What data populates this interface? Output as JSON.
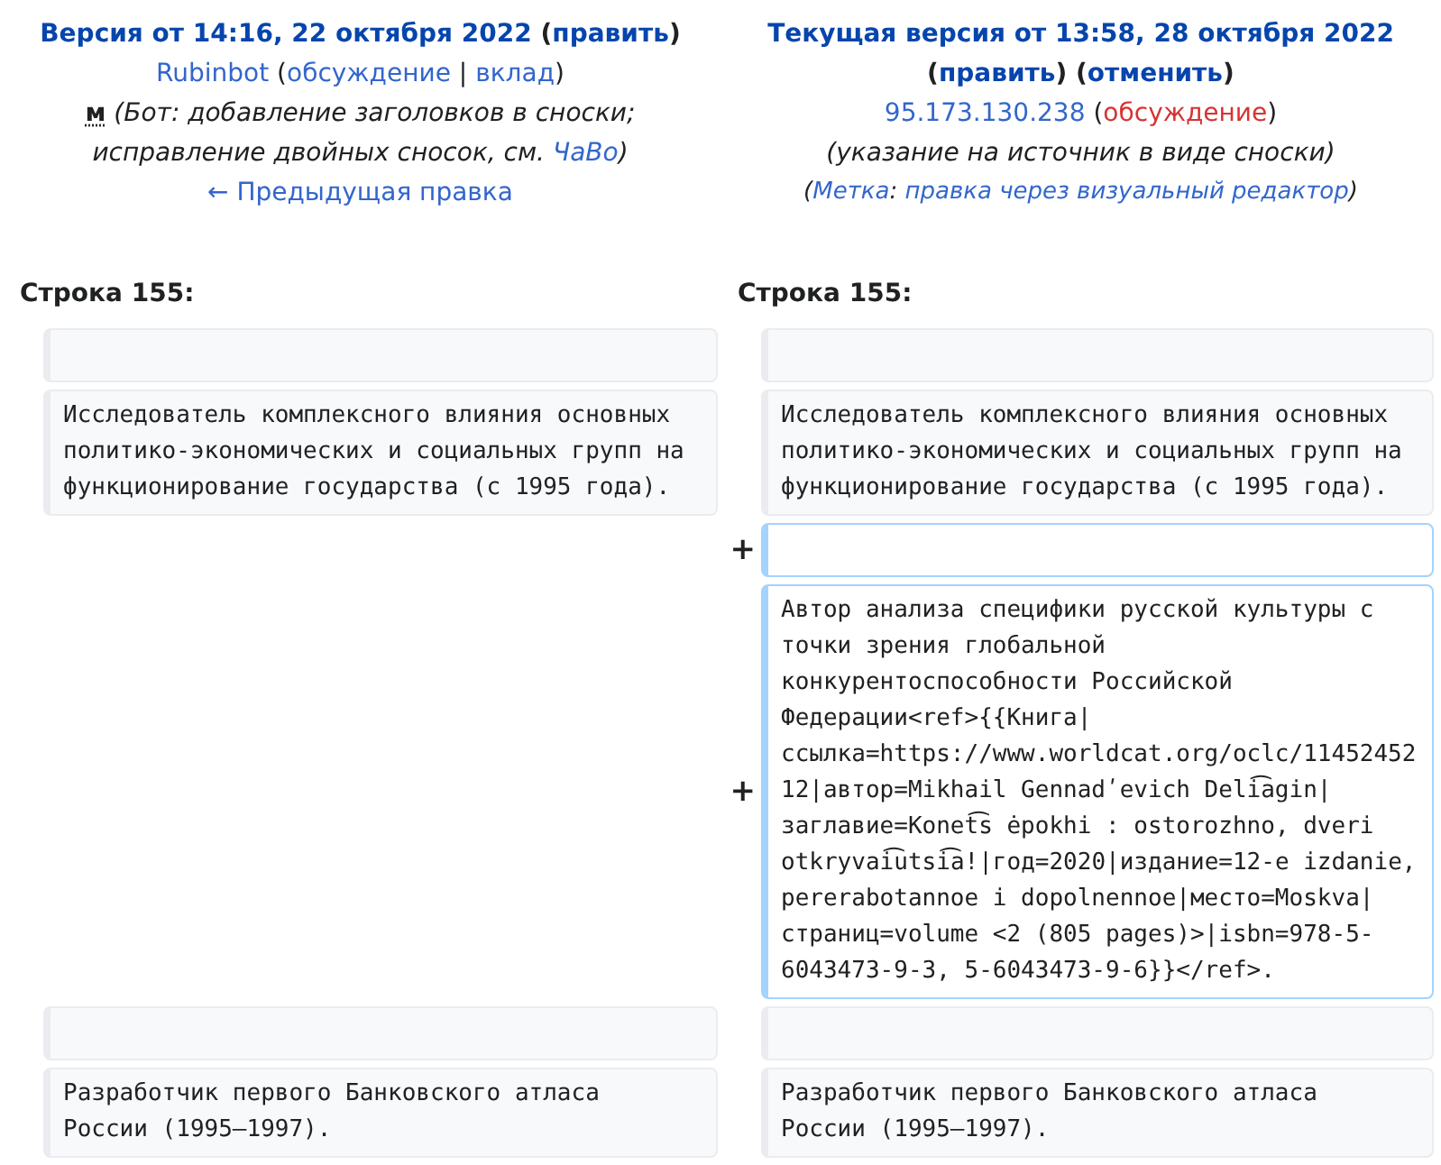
{
  "revisions": [
    {
      "lines": [
        {
          "kind": "heading",
          "segments": [
            {
              "kind": "link",
              "text": "Версия от 14:16, 22 октября 2022"
            },
            {
              "kind": "plain",
              "text": " ("
            },
            {
              "kind": "link",
              "text": "править"
            },
            {
              "kind": "plain",
              "text": ")"
            }
          ]
        },
        {
          "kind": "author",
          "segments": [
            {
              "kind": "link",
              "text": "Rubinbot"
            },
            {
              "kind": "plain",
              "text": " ("
            },
            {
              "kind": "link",
              "text": "обсуждение"
            },
            {
              "kind": "plain",
              "text": " | "
            },
            {
              "kind": "link",
              "text": "вклад"
            },
            {
              "kind": "plain",
              "text": ")"
            }
          ]
        },
        {
          "kind": "comment",
          "segments": [
            {
              "kind": "minor",
              "text": "м"
            },
            {
              "kind": "plain",
              "text": " (Бот: добавление заголовков в сноски; исправление двойных сносок, см. "
            },
            {
              "kind": "link",
              "text": "ЧаВо"
            },
            {
              "kind": "plain",
              "text": ")"
            }
          ]
        },
        {
          "kind": "nav",
          "segments": [
            {
              "kind": "link",
              "text": "← Предыдущая правка"
            }
          ]
        }
      ]
    },
    {
      "lines": [
        {
          "kind": "heading",
          "segments": [
            {
              "kind": "link",
              "text": "Текущая версия от 13:58, 28 октября 2022"
            },
            {
              "kind": "plain",
              "text": " ("
            },
            {
              "kind": "link",
              "text": "править"
            },
            {
              "kind": "plain",
              "text": ") ("
            },
            {
              "kind": "link",
              "text": "отменить"
            },
            {
              "kind": "plain",
              "text": ")"
            }
          ]
        },
        {
          "kind": "author",
          "segments": [
            {
              "kind": "link",
              "text": "95.173.130.238"
            },
            {
              "kind": "plain",
              "text": " ("
            },
            {
              "kind": "redlink",
              "text": "обсуждение"
            },
            {
              "kind": "plain",
              "text": ")"
            }
          ]
        },
        {
          "kind": "comment",
          "segments": [
            {
              "kind": "plain",
              "text": "(указание на источник в виде сноски)"
            }
          ]
        },
        {
          "kind": "tag",
          "segments": [
            {
              "kind": "plain",
              "text": "("
            },
            {
              "kind": "link",
              "text": "Метка"
            },
            {
              "kind": "plain",
              "text": ": "
            },
            {
              "kind": "link",
              "text": "правка через визуальный редактор"
            },
            {
              "kind": "plain",
              "text": ")"
            }
          ]
        }
      ]
    }
  ],
  "diff": {
    "line_headers": [
      "Строка 155:",
      "Строка 155:"
    ],
    "rows": [
      {
        "cells": [
          {
            "kind": "context"
          },
          {
            "kind": "context"
          }
        ]
      },
      {
        "cells": [
          {
            "kind": "context",
            "text": "Исследователь комплексного влияния основных политико-экономических и социальных групп на функционирование государства (с 1995 года)."
          },
          {
            "kind": "context",
            "text": "Исследователь комплексного влияния основных политико-экономических и социальных групп на функционирование государства (с 1995 года)."
          }
        ]
      },
      {
        "cells": [
          {
            "kind": "empty"
          },
          {
            "kind": "added",
            "marker": "+"
          }
        ]
      },
      {
        "cells": [
          {
            "kind": "empty"
          },
          {
            "kind": "added",
            "marker": "+",
            "text": "Автор анализа специфики русской культуры с точки зрения глобальной конкурентоспособности Российской Федерации<ref>{{Книга|ссылка=https://www.worldcat.org/oclc/1145245212|автор=Mikhail Gennadʹevich Deli͡agin|заглавие=Konet͡s ėpokhi : ostorozhno, dveri otkryvai͡utsi͡a!|год=2020|издание=12-e izdanie, pererabotannoe i dopolnennoe|место=Moskva|страниц=volume <2 (805 pages)>|isbn=978-5-6043473-9-3, 5-6043473-9-6}}</ref>."
          }
        ]
      },
      {
        "cells": [
          {
            "kind": "context"
          },
          {
            "kind": "context"
          }
        ]
      },
      {
        "cells": [
          {
            "kind": "context",
            "text": "Разработчик первого Банковского атласа России (1995—1997)."
          },
          {
            "kind": "context",
            "text": "Разработчик первого Банковского атласа России (1995—1997)."
          }
        ]
      }
    ]
  }
}
